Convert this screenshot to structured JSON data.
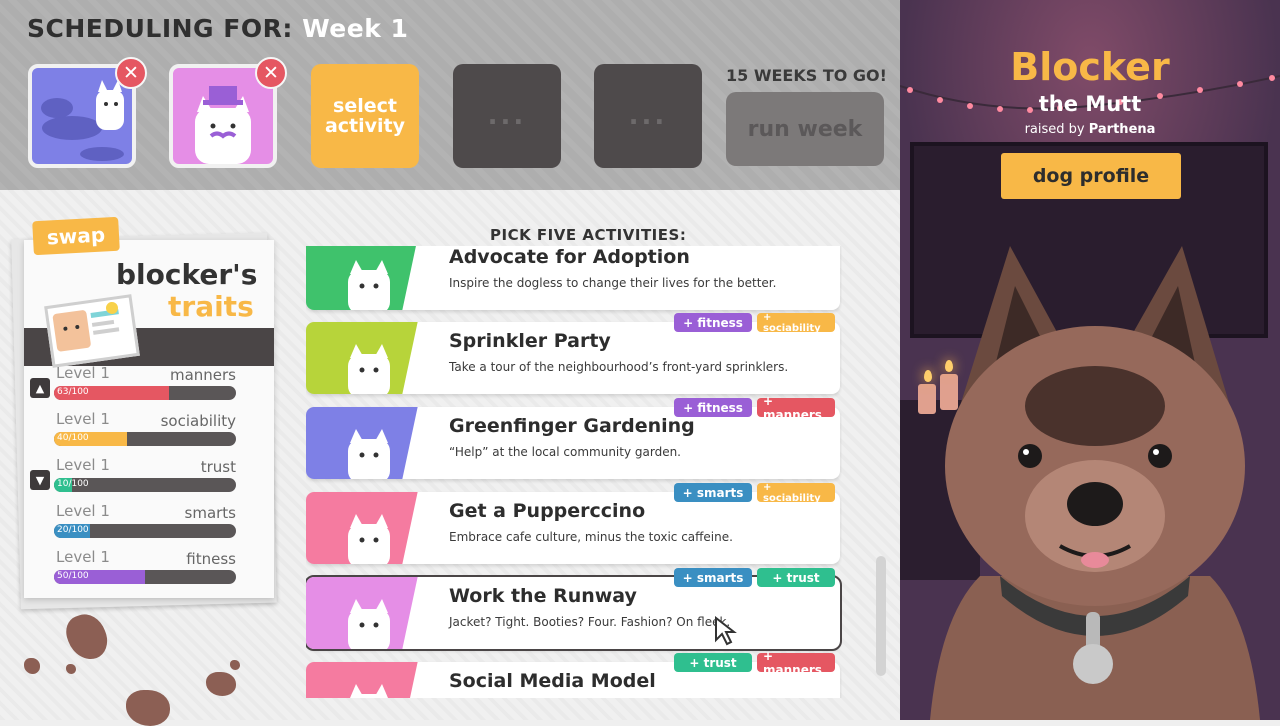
{
  "header": {
    "label": "SCHEDULING FOR:",
    "week": "Week 1"
  },
  "slots": {
    "select_label_1": "select",
    "select_label_2": "activity",
    "empty_label": "...",
    "remove_symbol": "✕"
  },
  "weeks_to_go": "15 WEEKS TO GO!",
  "run_week": "run week",
  "traits": {
    "swap": "swap",
    "title_name": "blocker's",
    "title_word": "traits",
    "items": [
      {
        "level": "Level 1",
        "name": "manners",
        "value_text": "63/100",
        "fraction": 0.63,
        "color": "#e55762",
        "arrow": "up"
      },
      {
        "level": "Level 1",
        "name": "sociability",
        "value_text": "40/100",
        "fraction": 0.4,
        "color": "#f8b847",
        "arrow": ""
      },
      {
        "level": "Level 1",
        "name": "trust",
        "value_text": "10/100",
        "fraction": 0.1,
        "color": "#2fbf8f",
        "arrow": "down"
      },
      {
        "level": "Level 1",
        "name": "smarts",
        "value_text": "20/100",
        "fraction": 0.2,
        "color": "#3a8fc2",
        "arrow": ""
      },
      {
        "level": "Level 1",
        "name": "fitness",
        "value_text": "50/100",
        "fraction": 0.5,
        "color": "#9a5fd6",
        "arrow": ""
      }
    ]
  },
  "activities_header": "PICK FIVE ACTIVITIES:",
  "activities": [
    {
      "title": "Advocate for Adoption",
      "desc": "Inspire the dogless to change their lives for the better.",
      "art_color": "#3fc26c",
      "tags": []
    },
    {
      "title": "Sprinkler Party",
      "desc": "Take a tour of the neighbourhood’s front-yard sprinklers.",
      "art_color": "#b7d43a",
      "tags": [
        {
          "label": "+ fitness",
          "color": "#9a5fd6"
        },
        {
          "label": "+ sociability",
          "color": "#f8b847"
        }
      ]
    },
    {
      "title": "Greenfinger Gardening",
      "desc": "“Help” at the local community garden.",
      "art_color": "#7e80e6",
      "tags": [
        {
          "label": "+ fitness",
          "color": "#9a5fd6"
        },
        {
          "label": "+ manners",
          "color": "#e55762"
        }
      ]
    },
    {
      "title": "Get a Pupperccino",
      "desc": "Embrace cafe culture, minus the toxic caffeine.",
      "art_color": "#f57ba0",
      "tags": [
        {
          "label": "+ smarts",
          "color": "#3a8fc2"
        },
        {
          "label": "+ sociability",
          "color": "#f8b847"
        }
      ]
    },
    {
      "title": "Work the Runway",
      "desc": "Jacket? Tight. Booties? Four. Fashion? On fleek.",
      "art_color": "#e58ee6",
      "tags": [
        {
          "label": "+ smarts",
          "color": "#3a8fc2"
        },
        {
          "label": "+ trust",
          "color": "#2fbf8f"
        }
      ]
    },
    {
      "title": "Social Media Model",
      "desc": "",
      "art_color": "#f57ba0",
      "tags": [
        {
          "label": "+ trust",
          "color": "#2fbf8f"
        },
        {
          "label": "+ manners",
          "color": "#e55762"
        }
      ]
    }
  ],
  "dog": {
    "name": "Blocker",
    "breed": "the Mutt",
    "raised_by_prefix": "raised by",
    "owner": "Parthena",
    "profile_button": "dog profile"
  },
  "colors": {
    "accent": "#f8b847",
    "remove": "#e55762",
    "panel": "#4a3350"
  }
}
